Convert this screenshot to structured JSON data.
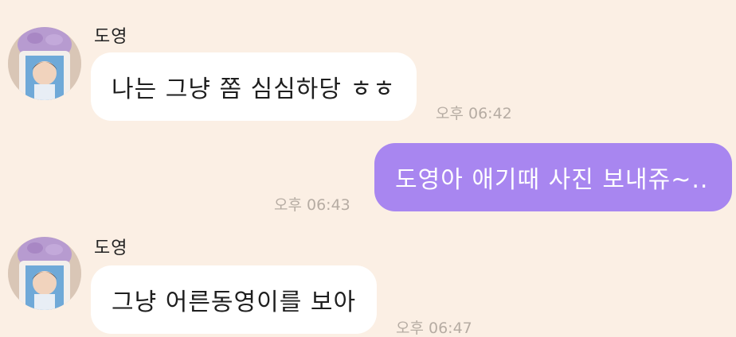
{
  "messages": [
    {
      "sender": "도영",
      "text": "나는 그냥 쫌 심심하당 ㅎㅎ",
      "time": "오후 06:42"
    },
    {
      "text": "도영아 애기때 사진 보내쥬~..",
      "time": "오후 06:43"
    },
    {
      "sender": "도영",
      "text": "그냥 어른동영이를 보아",
      "time": "오후 06:47"
    }
  ],
  "colors": {
    "background": "#fbefe4",
    "incoming_bubble": "#ffffff",
    "outgoing_bubble": "#a886f0",
    "timestamp": "#b6aca3"
  },
  "icons": {
    "avatar": "profile-photo-cup-icon"
  }
}
